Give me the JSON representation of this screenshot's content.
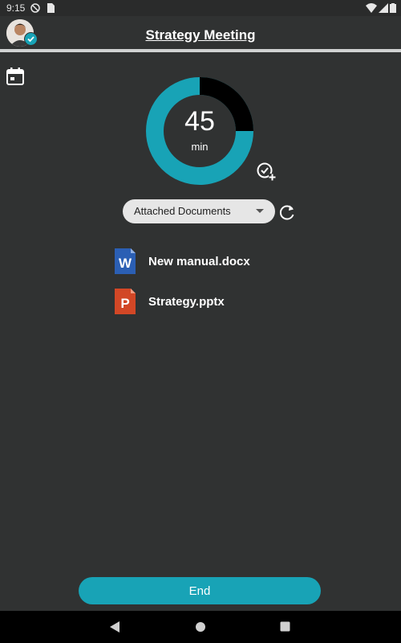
{
  "status": {
    "time": "9:15"
  },
  "header": {
    "title": "Strategy Meeting"
  },
  "timer": {
    "value": "45",
    "unit": "min",
    "elapsed_fraction": 0.25,
    "ring_color": "#18a3b6",
    "elapsed_color": "#000000"
  },
  "documents": {
    "dropdown_selected": "Attached Documents",
    "items": [
      {
        "name": "New manual.docx",
        "icon": "word-doc-icon",
        "icon_letter": "W",
        "color": "#2b5fb4"
      },
      {
        "name": "Strategy.pptx",
        "icon": "powerpoint-doc-icon",
        "icon_letter": "P",
        "color": "#d24726"
      }
    ]
  },
  "actions": {
    "end_label": "End"
  },
  "colors": {
    "accent": "#18a3b6",
    "background": "#303232"
  }
}
